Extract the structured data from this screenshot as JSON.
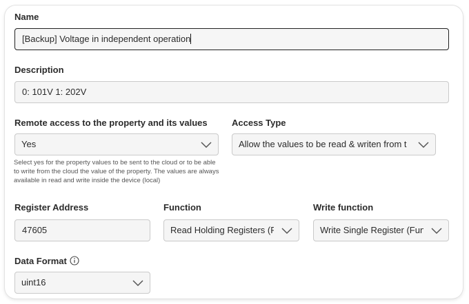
{
  "name": {
    "label": "Name",
    "value": "[Backup] Voltage in independent operation"
  },
  "description": {
    "label": "Description",
    "value": "0: 101V 1: 202V"
  },
  "remote_access": {
    "label": "Remote access to the property and its values",
    "value": "Yes",
    "help": "Select yes for the property values to be sent to the cloud or to be able to write from the cloud the value of the property. The values are always available in read and write inside the device (local)"
  },
  "access_type": {
    "label": "Access Type",
    "value": "Allow the values to be read & writen from t"
  },
  "register_address": {
    "label": "Register Address",
    "value": "47605"
  },
  "function": {
    "label": "Function",
    "value": "Read Holding Registers (F"
  },
  "write_function": {
    "label": "Write function",
    "value": "Write Single Register (Fun"
  },
  "data_format": {
    "label": "Data Format",
    "value": "uint16",
    "icon": "info-icon"
  }
}
